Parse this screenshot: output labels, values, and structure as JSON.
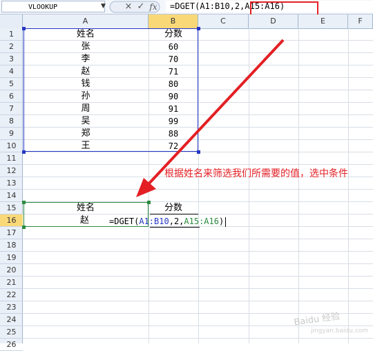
{
  "formula_bar": {
    "name_box": "VLOOKUP",
    "cancel_icon": "×",
    "enter_icon": "✓",
    "fx_label": "fx",
    "formula": "=DGET(A1:B10,2,A15:A16)"
  },
  "columns": [
    "A",
    "B",
    "C",
    "D",
    "E",
    "F"
  ],
  "rows": [
    "1",
    "2",
    "3",
    "4",
    "5",
    "6",
    "7",
    "8",
    "9",
    "10",
    "11",
    "12",
    "13",
    "14",
    "15",
    "16",
    "17",
    "18",
    "19",
    "20",
    "21",
    "22",
    "23",
    "24",
    "25",
    "26"
  ],
  "table": {
    "header_name": "姓名",
    "header_score": "分数",
    "records": [
      {
        "name": "张",
        "score": "60"
      },
      {
        "name": "李",
        "score": "70"
      },
      {
        "name": "赵",
        "score": "71"
      },
      {
        "name": "钱",
        "score": "80"
      },
      {
        "name": "孙",
        "score": "90"
      },
      {
        "name": "周",
        "score": "91"
      },
      {
        "name": "吴",
        "score": "99"
      },
      {
        "name": "郑",
        "score": "88"
      },
      {
        "name": "王",
        "score": "72"
      }
    ]
  },
  "criteria": {
    "header_name": "姓名",
    "header_score": "分数",
    "name_value": "赵",
    "formula_prefix": "=DGET(",
    "ref_range": "A1:B10",
    "mid": ",2,",
    "ref_criteria": "A15:A16",
    "suffix": ")"
  },
  "annotation": "根据姓名来筛选我们所需要的值，选中条件",
  "watermark": "Baidu 经验",
  "watermark_sub": "jingyan.baidu.com",
  "colors": {
    "annotation_red": "#e31f24",
    "range_blue": "#2437c4",
    "criteria_green": "#2b8a3e",
    "header_active": "#f9d878"
  }
}
